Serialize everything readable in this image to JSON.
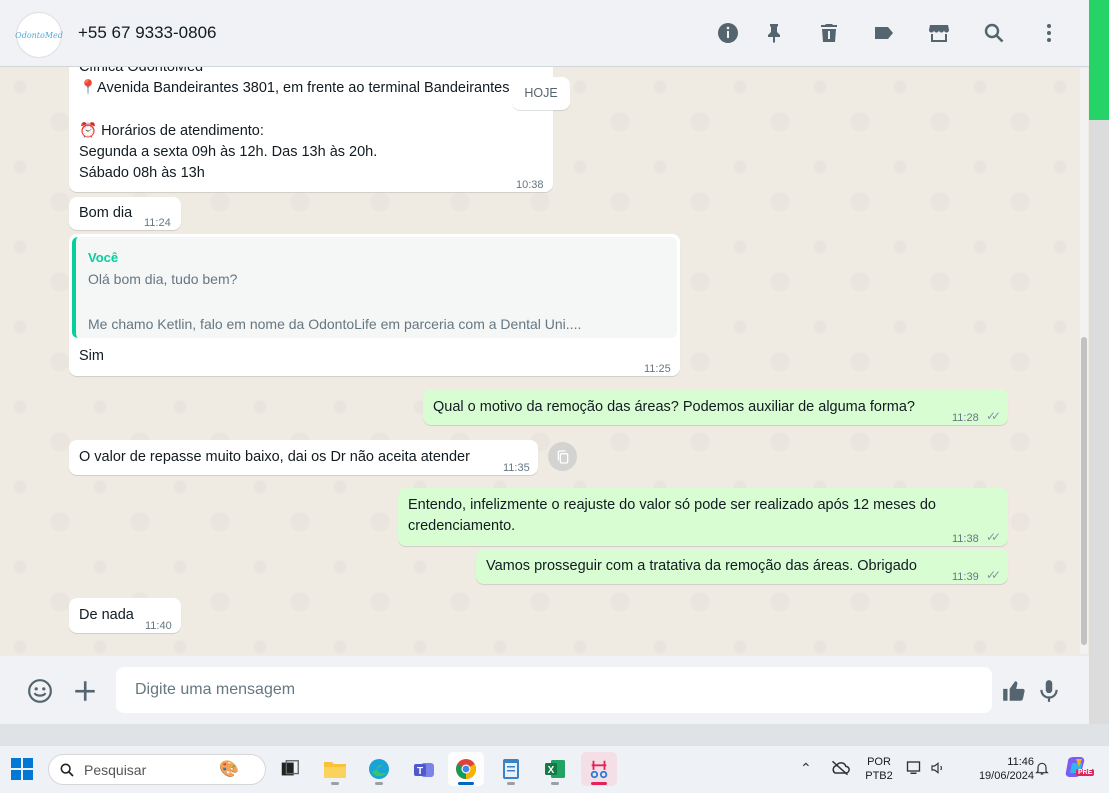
{
  "header": {
    "contact_name": "+55 67 9333-0806",
    "avatar_text": "OdontoMed",
    "icons": [
      "info-icon",
      "pin-icon",
      "delete-icon",
      "label-icon",
      "catalog-icon",
      "search-icon",
      "menu-icon"
    ]
  },
  "chat": {
    "first_msg": {
      "line1": "Clínica OdontoMed",
      "line2": "📍Avenida Bandeirantes 3801, em frente ao terminal Bandeirantes",
      "line3": "⏰ Horários de atendimento:",
      "line4": "Segunda a sexta 09h às 12h. Das 13h às 20h.",
      "line5": "Sábado 08h às 13h",
      "time": "10:38"
    },
    "date_badge": "HOJE",
    "msg2": {
      "text": "Bom dia",
      "time": "11:24"
    },
    "msg3": {
      "quote_author": "Você",
      "quote_line1": "Olá bom dia, tudo bem?",
      "quote_line2": "Me chamo Ketlin, falo em nome da OdontoLife em parceria com a Dental Uni....",
      "text": "Sim",
      "time": "11:25"
    },
    "msg4": {
      "text": "Qual o motivo da remoção das áreas? Podemos auxiliar de alguma forma?",
      "time": "11:28"
    },
    "msg5": {
      "text": "O valor de repasse muito baixo, dai os Dr não aceita atender",
      "time": "11:35"
    },
    "msg6": {
      "line1": "Entendo, infelizmente o reajuste do valor só pode ser realizado após 12 meses do",
      "line2": "credenciamento.",
      "time": "11:38"
    },
    "msg7": {
      "text": "Vamos prosseguir com a tratativa da remoção das áreas. Obrigado",
      "time": "11:39"
    },
    "msg8": {
      "text": "De nada",
      "time": "11:40"
    },
    "read_ticks": "✓✓"
  },
  "footer": {
    "placeholder": "Digite uma mensagem"
  },
  "taskbar": {
    "search_label": "Pesquisar",
    "lang_line1": "POR",
    "lang_line2": "PTB2",
    "clock_time": "11:46",
    "clock_date": "19/06/2024",
    "copilot_badge": "PRE"
  }
}
